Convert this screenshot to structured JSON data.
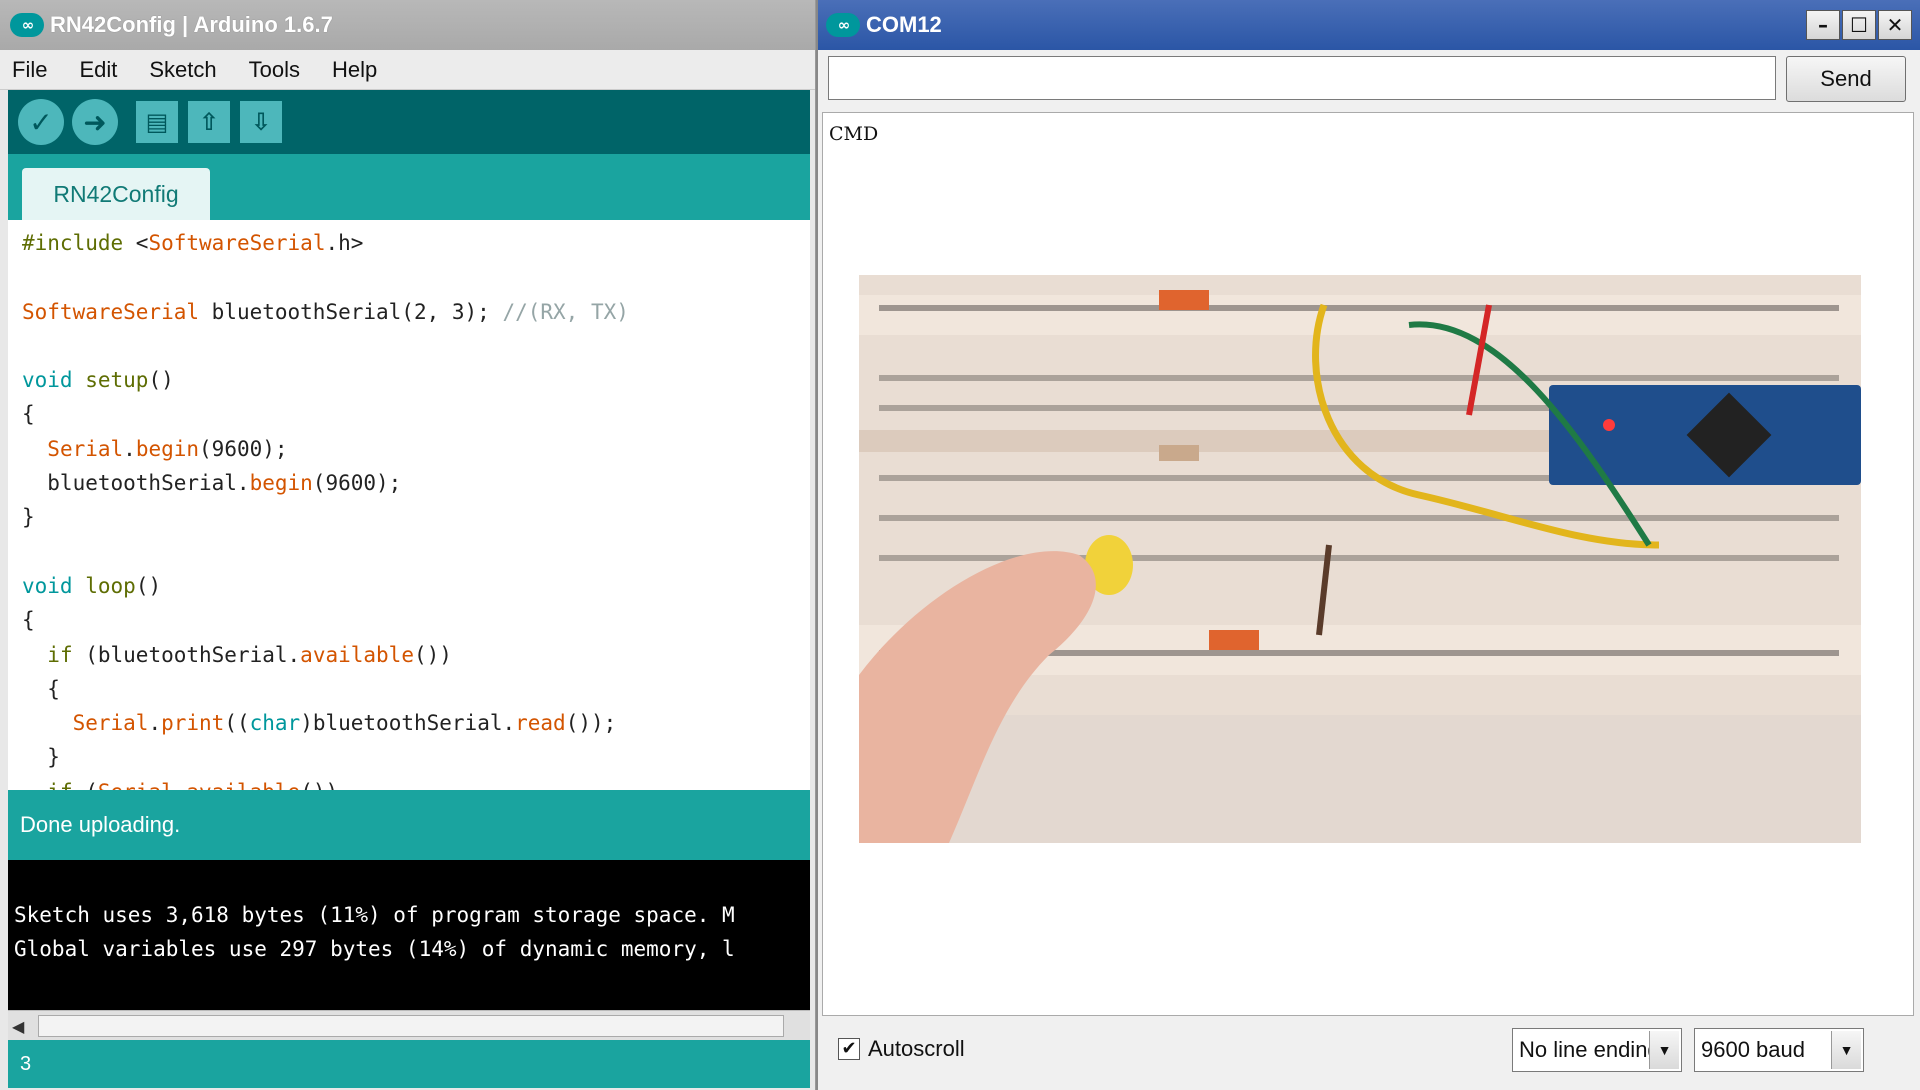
{
  "ide": {
    "title": "RN42Config | Arduino 1.6.7",
    "menu": [
      "File",
      "Edit",
      "Sketch",
      "Tools",
      "Help"
    ],
    "toolbar": {
      "verify_icon": "check-icon",
      "upload_icon": "arrow-right-icon",
      "new_icon": "document-icon",
      "open_icon": "arrow-up-icon",
      "save_icon": "arrow-down-icon"
    },
    "tab": "RN42Config",
    "status": "Done uploading.",
    "console_lines": [
      "Sketch uses 3,618 bytes (11%) of program storage space. M",
      "Global variables use 297 bytes (14%) of dynamic memory, l"
    ],
    "line_number": "3",
    "accent_color": "#00979c"
  },
  "monitor": {
    "title": "COM12",
    "send_value": "",
    "send_label": "Send",
    "output": "CMD",
    "autoscroll_label": "Autoscroll",
    "autoscroll_checked": true,
    "line_ending": "No line ending",
    "baud": "9600 baud",
    "window_buttons": [
      "minimize-icon",
      "maximize-icon",
      "close-icon"
    ]
  }
}
